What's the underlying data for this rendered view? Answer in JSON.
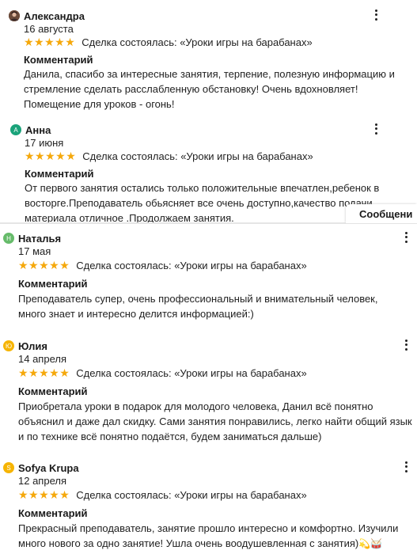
{
  "colors": {
    "star": "#f5a80b",
    "avatar_anna": "#1aa37a",
    "avatar_natalya": "#66bb6a",
    "avatar_yulia": "#f6b400",
    "avatar_sofya": "#f6b400"
  },
  "messages_tab": {
    "label": "Сообщени"
  },
  "reviews": [
    {
      "name": "Александра",
      "avatar_letter": "",
      "date": "16 августа",
      "rating": 5,
      "stars": "★★★★★",
      "deal": "Сделка состоялась: «Уроки игры на барабанах»",
      "comment_label": "Комментарий",
      "comment_lines": [
        "Данила, спасибо за интересные занятия, терпение, полезную информацию и",
        "стремление сделать расслабленную обстановку! Очень вдохновляет!",
        "Помещение для уроков - огонь!"
      ]
    },
    {
      "name": "Анна",
      "avatar_letter": "А",
      "date": "17 июня",
      "rating": 5,
      "stars": "★★★★★",
      "deal": "Сделка состоялась: «Уроки игры на барабанах»",
      "comment_label": "Комментарий",
      "comment_lines": [
        "От первого занятия остались только положительные впечатлен,ребенок в",
        "восторге.Преподаватель обьясняет все очень доступно,качество подачи",
        "материала отличное .Продолжаем занятия."
      ]
    },
    {
      "name": "Наталья",
      "avatar_letter": "Н",
      "date": "17 мая",
      "rating": 5,
      "stars": "★★★★★",
      "deal": "Сделка состоялась: «Уроки игры на барабанах»",
      "comment_label": "Комментарий",
      "comment_lines": [
        "Преподаватель супер, очень профессиональный и внимательный человек,",
        "много знает и интересно делится информацией:)"
      ]
    },
    {
      "name": "Юлия",
      "avatar_letter": "Ю",
      "date": "14 апреля",
      "rating": 5,
      "stars": "★★★★★",
      "deal": "Сделка состоялась: «Уроки игры на барабанах»",
      "comment_label": "Комментарий",
      "comment_lines": [
        "Приобретала уроки в подарок для молодого человека, Данил всё понятно",
        "объяснил и даже дал скидку. Сами занятия понравились, легко найти общий язык",
        "и по технике всё понятно подаётся, будем заниматься дальше)"
      ]
    },
    {
      "name": "Sofya Krupa",
      "avatar_letter": "S",
      "date": "12 апреля",
      "rating": 5,
      "stars": "★★★★★",
      "deal": "Сделка состоялась: «Уроки игры на барабанах»",
      "comment_label": "Комментарий",
      "comment_lines": [
        "Прекрасный преподаватель, занятие прошло интересно и комфортно. Изучили",
        "много нового за одно занятие! Ушла очень воодушевленная с занятия)"
      ],
      "comment_emoji": "💫🥁"
    }
  ]
}
